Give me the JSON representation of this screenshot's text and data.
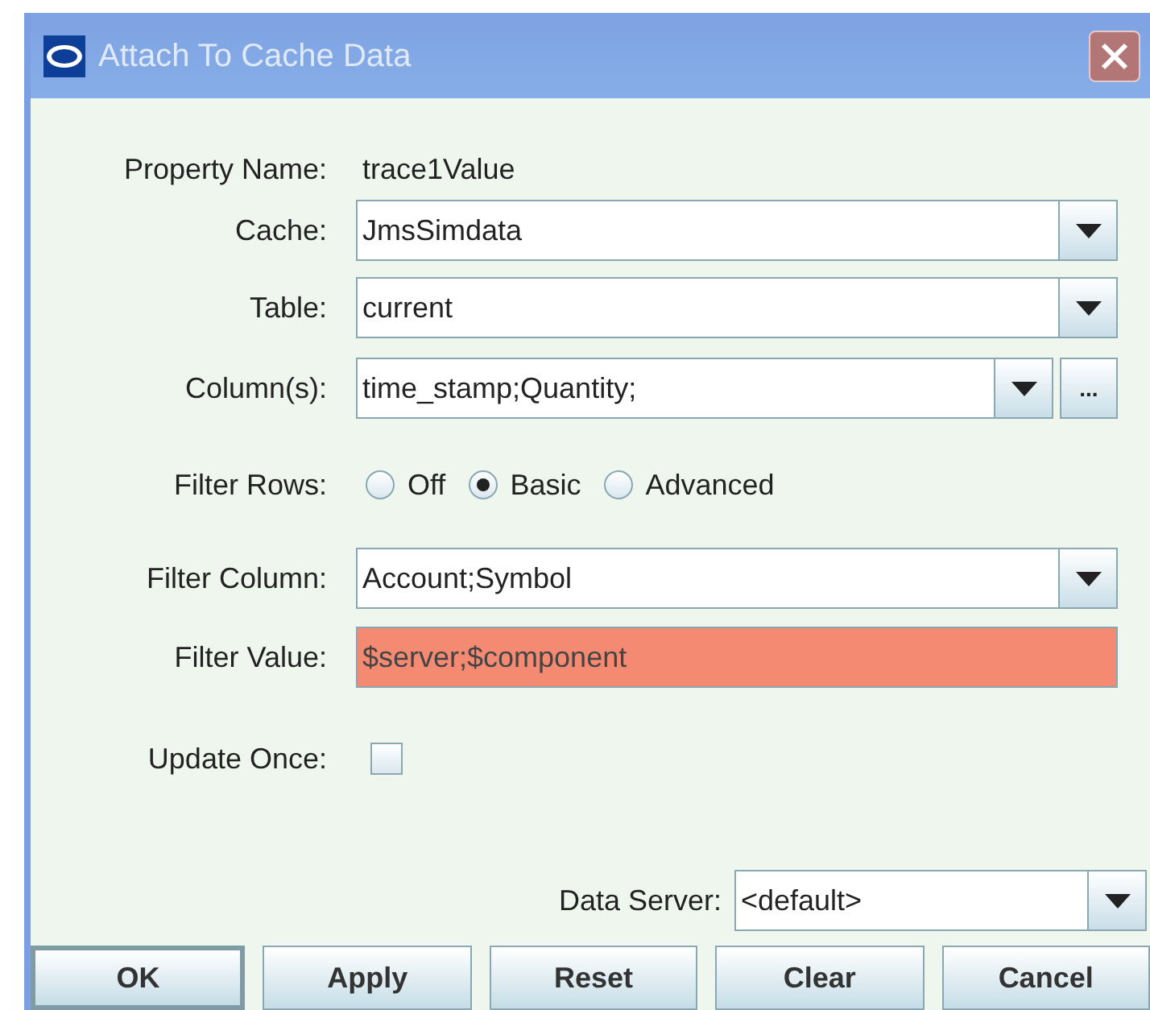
{
  "window": {
    "title": "Attach To Cache Data"
  },
  "rows": [
    {
      "kind": "text",
      "label": "Property Name:",
      "value": "trace1Value"
    },
    {
      "kind": "combo",
      "label": "Cache:",
      "value": "JmsSimdata"
    },
    {
      "kind": "combo",
      "label": "Table:",
      "value": "current"
    },
    {
      "kind": "combo_more",
      "label": "Column(s):",
      "value": "time_stamp;Quantity;",
      "more": "..."
    },
    {
      "kind": "radio",
      "label": "Filter Rows:",
      "options": [
        {
          "label": "Off",
          "selected": false
        },
        {
          "label": "Basic",
          "selected": true
        },
        {
          "label": "Advanced",
          "selected": false
        }
      ]
    },
    {
      "kind": "combo",
      "label": "Filter Column:",
      "value": "Account;Symbol"
    },
    {
      "kind": "field",
      "label": "Filter Value:",
      "value": "$server;$component",
      "invalid": true
    },
    {
      "kind": "checkbox",
      "label": "Update Once:",
      "checked": false
    }
  ],
  "data_server": {
    "label": "Data Server:",
    "value": "<default>"
  },
  "buttons": [
    {
      "label": "OK",
      "default": true
    },
    {
      "label": "Apply",
      "default": false
    },
    {
      "label": "Reset",
      "default": false
    },
    {
      "label": "Clear",
      "default": false
    },
    {
      "label": "Cancel",
      "default": false
    }
  ]
}
